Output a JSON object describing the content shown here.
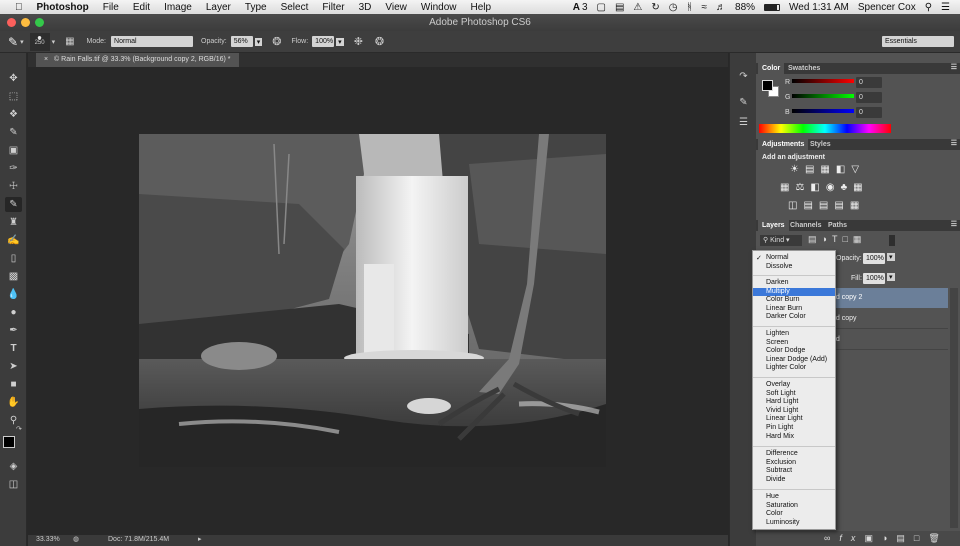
{
  "menubar": {
    "apple": "",
    "app_name": "Photoshop",
    "items": [
      "File",
      "Edit",
      "Image",
      "Layer",
      "Type",
      "Select",
      "Filter",
      "3D",
      "View",
      "Window",
      "Help"
    ],
    "status": {
      "adobe_count": "3",
      "battery": "88%",
      "clock": "Wed 1:31 AM",
      "user": "Spencer Cox"
    }
  },
  "window": {
    "title": "Adobe Photoshop CS6"
  },
  "options": {
    "brush_size": "250",
    "mode_label": "Mode:",
    "mode_value": "Normal",
    "opacity_label": "Opacity:",
    "opacity_value": "56%",
    "flow_label": "Flow:",
    "flow_value": "100%",
    "workspace": "Essentials"
  },
  "document": {
    "tab": "© Rain Falls.tif @ 33.3% (Background copy 2, RGB/16) *"
  },
  "status": {
    "zoom": "33.33%",
    "doc": "Doc: 71.8M/215.4M"
  },
  "color_panel": {
    "tabs": [
      "Color",
      "Swatches"
    ],
    "r_label": "R",
    "r": "0",
    "g_label": "G",
    "g": "0",
    "b_label": "B",
    "b": "0"
  },
  "adjustments": {
    "tabs": [
      "Adjustments",
      "Styles"
    ],
    "title": "Add an adjustment"
  },
  "layers": {
    "tabs": [
      "Layers",
      "Channels",
      "Paths"
    ],
    "kind": "Kind",
    "opacity_label": "Opacity:",
    "opacity": "100%",
    "fill_label": "Fill:",
    "fill": "100%",
    "rows": [
      "nd copy 2",
      "nd copy",
      "nd"
    ]
  },
  "blend_menu": {
    "checked": "Normal",
    "selected": "Multiply",
    "groups": [
      [
        "Normal",
        "Dissolve"
      ],
      [
        "Darken",
        "Multiply",
        "Color Burn",
        "Linear Burn",
        "Darker Color"
      ],
      [
        "Lighten",
        "Screen",
        "Color Dodge",
        "Linear Dodge (Add)",
        "Lighter Color"
      ],
      [
        "Overlay",
        "Soft Light",
        "Hard Light",
        "Vivid Light",
        "Linear Light",
        "Pin Light",
        "Hard Mix"
      ],
      [
        "Difference",
        "Exclusion",
        "Subtract",
        "Divide"
      ],
      [
        "Hue",
        "Saturation",
        "Color",
        "Luminosity"
      ]
    ]
  },
  "colors": {
    "selection": "#3b78d9",
    "panel": "#535353",
    "canvas": "#282828"
  }
}
